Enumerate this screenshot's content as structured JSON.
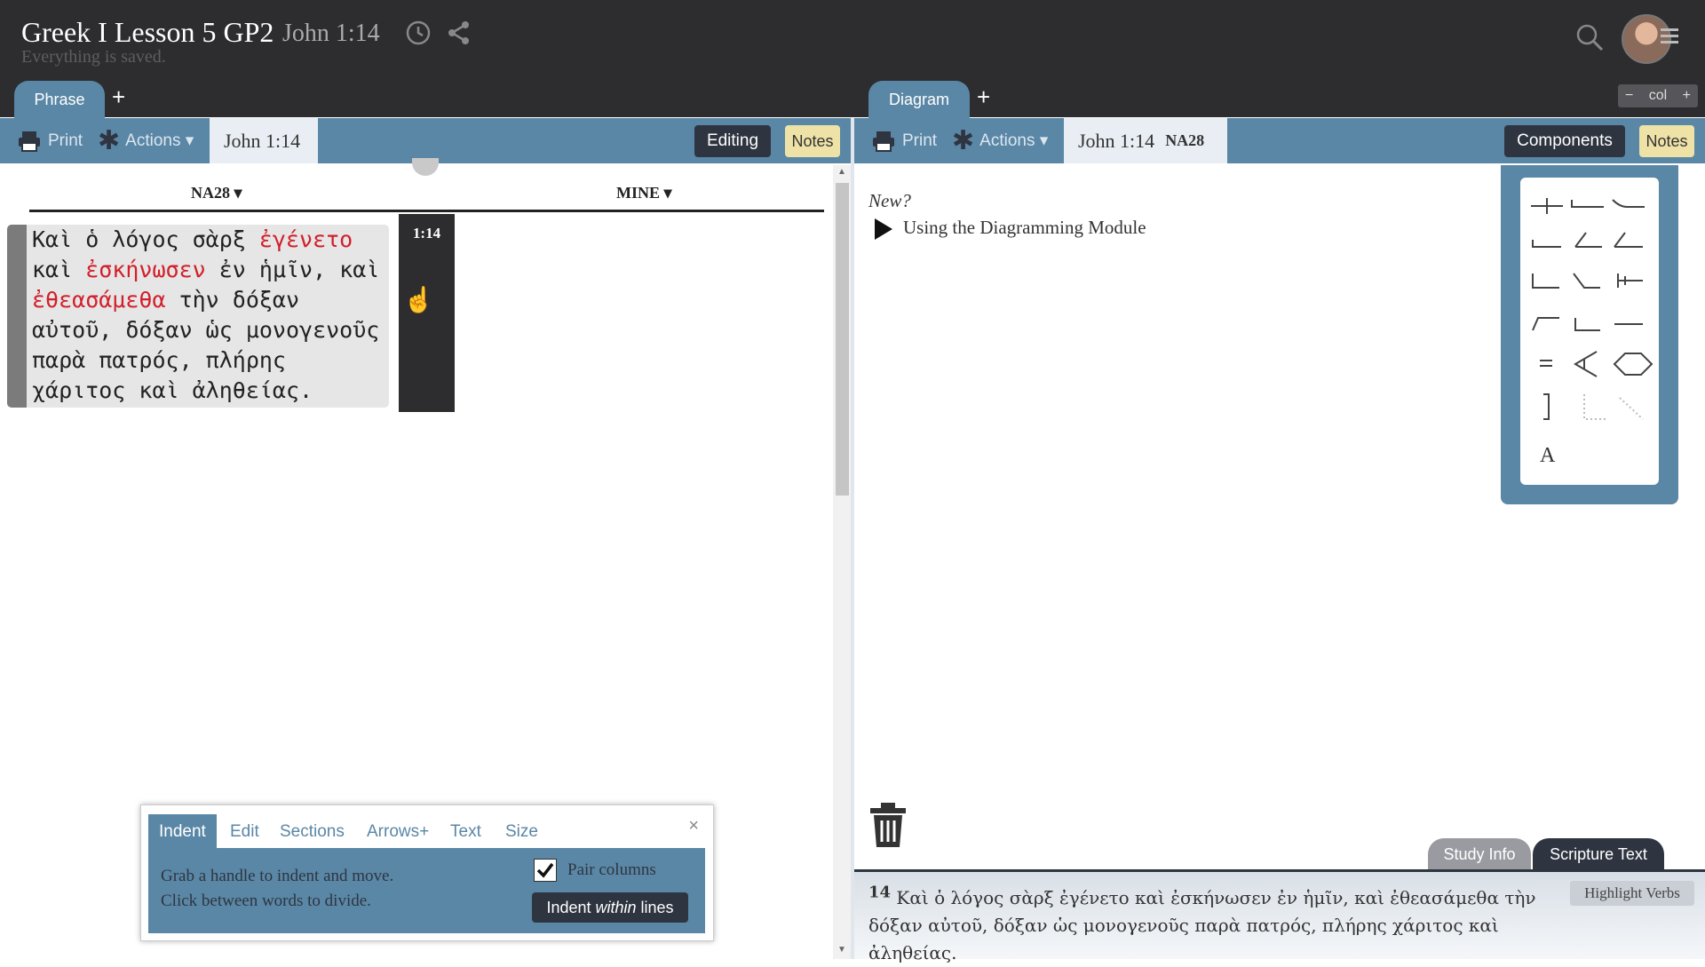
{
  "header": {
    "title": "Greek I Lesson 5 GP2",
    "reference": "John 1:14",
    "status": "Everything is saved.",
    "icons": [
      "history-icon",
      "share-icon",
      "search-icon",
      "avatar",
      "menu-icon"
    ]
  },
  "left": {
    "tab_label": "Phrase",
    "add_tab": "+",
    "toolbar": {
      "print": "Print",
      "actions": "Actions ▾",
      "reference": "John 1:14",
      "editing": "Editing",
      "notes": "Notes"
    },
    "columns": {
      "left": "NA28 ▾",
      "right": "MINE ▾"
    },
    "verse_label": "1:14",
    "phrase_segments": [
      {
        "text": "Καὶ ὁ λόγος σὰρξ ",
        "verb": false
      },
      {
        "text": "ἐγένετο",
        "verb": true
      },
      {
        "text": " καὶ ",
        "verb": false
      },
      {
        "text": "ἐσκήνωσεν",
        "verb": true
      },
      {
        "text": " ἐν ἡμῖν, καὶ ",
        "verb": false
      },
      {
        "text": "ἐθεασάμεθα",
        "verb": true
      },
      {
        "text": " τὴν δόξαν αὐτοῦ, δόξαν ὡς μονογενοῦς παρὰ πατρός, πλήρης χάριτος καὶ ἀληθείας.",
        "verb": false
      }
    ],
    "indent_panel": {
      "tabs": [
        "Indent",
        "Edit",
        "Sections",
        "Arrows+",
        "Text",
        "Size"
      ],
      "active_tab": "Indent",
      "close": "×",
      "line1": "Grab a handle to indent and move.",
      "line2": "Click between words to divide.",
      "pair_columns": "Pair columns",
      "pair_checked": true,
      "indent_btn_prefix": "Indent ",
      "indent_btn_em": "within",
      "indent_btn_suffix": " lines"
    }
  },
  "right": {
    "tab_label": "Diagram",
    "add_tab": "+",
    "col_control": {
      "minus": "−",
      "label": "col",
      "plus": "+"
    },
    "toolbar": {
      "print": "Print",
      "actions": "Actions ▾",
      "reference": "John 1:14",
      "edition": "NA28",
      "components": "Components",
      "notes": "Notes"
    },
    "new_label": "New?",
    "using_link": "Using the Diagramming Module",
    "component_text_tool": "A",
    "bottom_tabs": {
      "study_info": "Study Info",
      "scripture_text": "Scripture Text"
    },
    "scripture": {
      "verse_num": "14",
      "text": "Καὶ ὁ λόγος σὰρξ ἐγένετο καὶ ἐσκήνωσεν ἐν ἡμῖν, καὶ ἐθεασάμεθα τὴν δόξαν αὐτοῦ, δόξαν ὡς μονογενοῦς παρὰ πατρός, πλήρης χάριτος καὶ ἀληθείας."
    },
    "highlight_verbs": "Highlight Verbs"
  },
  "colors": {
    "dark": "#2d2d30",
    "accent": "#5a87a6",
    "verb_red": "#d2202b",
    "notes_yellow": "#efe2a7"
  }
}
